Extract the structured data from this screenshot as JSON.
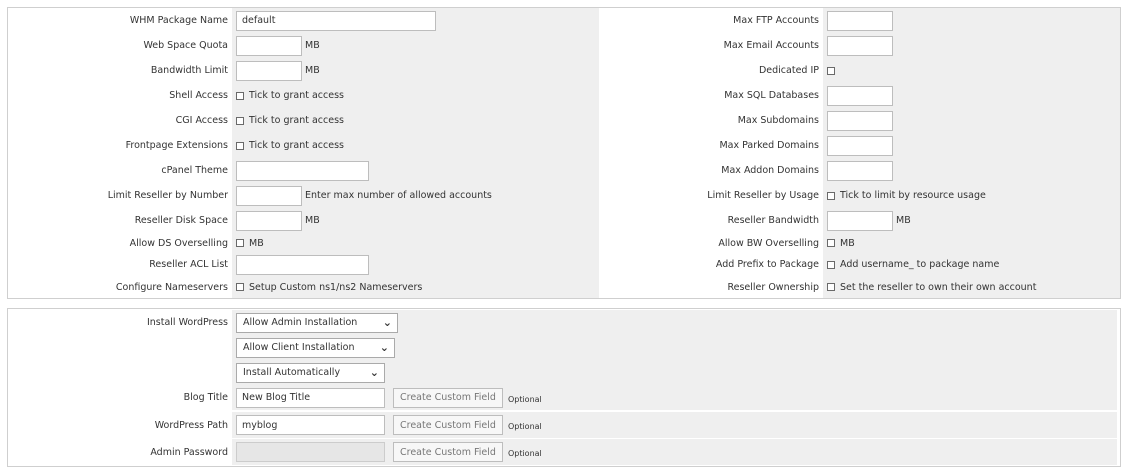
{
  "package": {
    "left": [
      {
        "label": "WHM Package Name",
        "kind": "input",
        "value": "default"
      },
      {
        "label": "Web Space Quota",
        "kind": "input",
        "value": "",
        "unit": "MB"
      },
      {
        "label": "Bandwidth Limit",
        "kind": "input",
        "value": "",
        "unit": "MB"
      },
      {
        "label": "Shell Access",
        "kind": "checkbox",
        "text": "Tick to grant access"
      },
      {
        "label": "CGI Access",
        "kind": "checkbox",
        "text": "Tick to grant access"
      },
      {
        "label": "Frontpage Extensions",
        "kind": "checkbox",
        "text": "Tick to grant access"
      },
      {
        "label": "cPanel Theme",
        "kind": "input",
        "value": ""
      },
      {
        "label": "Limit Reseller by Number",
        "kind": "input",
        "value": "",
        "unit": "Enter max number of allowed accounts"
      },
      {
        "label": "Reseller Disk Space",
        "kind": "input",
        "value": "",
        "unit": "MB"
      },
      {
        "label": "Allow DS Overselling",
        "kind": "checkbox",
        "text": "MB"
      },
      {
        "label": "Reseller ACL List",
        "kind": "input",
        "value": ""
      },
      {
        "label": "Configure Nameservers",
        "kind": "checkbox",
        "text": "Setup Custom ns1/ns2 Nameservers"
      }
    ],
    "right": [
      {
        "label": "Max FTP Accounts",
        "kind": "input",
        "value": ""
      },
      {
        "label": "Max Email Accounts",
        "kind": "input",
        "value": ""
      },
      {
        "label": "Dedicated IP",
        "kind": "checkbox",
        "text": ""
      },
      {
        "label": "Max SQL Databases",
        "kind": "input",
        "value": ""
      },
      {
        "label": "Max Subdomains",
        "kind": "input",
        "value": ""
      },
      {
        "label": "Max Parked Domains",
        "kind": "input",
        "value": ""
      },
      {
        "label": "Max Addon Domains",
        "kind": "input",
        "value": ""
      },
      {
        "label": "Limit Reseller by Usage",
        "kind": "checkbox",
        "text": "Tick to limit by resource usage"
      },
      {
        "label": "Reseller Bandwidth",
        "kind": "input",
        "value": "",
        "unit": "MB"
      },
      {
        "label": "Allow BW Overselling",
        "kind": "checkbox",
        "text": "MB"
      },
      {
        "label": "Add Prefix to Package",
        "kind": "checkbox",
        "text": "Add username_ to package name"
      },
      {
        "label": "Reseller Ownership",
        "kind": "checkbox",
        "text": "Set the reseller to own their own account"
      }
    ]
  },
  "wordpress": {
    "install_label": "Install WordPress",
    "select_admin": "Allow Admin Installation",
    "select_client": "Allow Client Installation",
    "select_auto": "Install Automatically",
    "blog_title_label": "Blog Title",
    "blog_title_value": "New Blog Title",
    "wp_path_label": "WordPress Path",
    "wp_path_value": "myblog",
    "admin_password_label": "Admin Password",
    "admin_password_value": "",
    "custom_field_button": "Create Custom Field",
    "optional_text": "Optional"
  },
  "colors": {
    "field_bg": "#efefef",
    "border": "#cfcfcf"
  }
}
